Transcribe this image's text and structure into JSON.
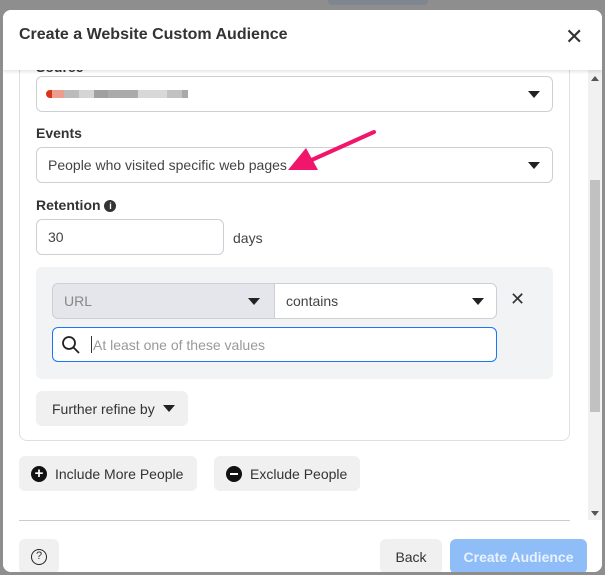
{
  "dialog": {
    "title": "Create a Website Custom Audience"
  },
  "source": {
    "label": "Source"
  },
  "events": {
    "label": "Events",
    "value": "People who visited specific web pages"
  },
  "retention": {
    "label": "Retention",
    "value": "30",
    "unit": "days"
  },
  "rule": {
    "field": "URL",
    "operator": "contains",
    "search_placeholder": "At least one of these values"
  },
  "refine": {
    "label": "Further refine by"
  },
  "include": {
    "label": "Include More People"
  },
  "exclude": {
    "label": "Exclude People"
  },
  "footer": {
    "back": "Back",
    "create": "Create Audience"
  },
  "colors": {
    "arrow": "#f0166b",
    "primary_disabled": "#8fbdf7",
    "focus": "#1877f2"
  }
}
